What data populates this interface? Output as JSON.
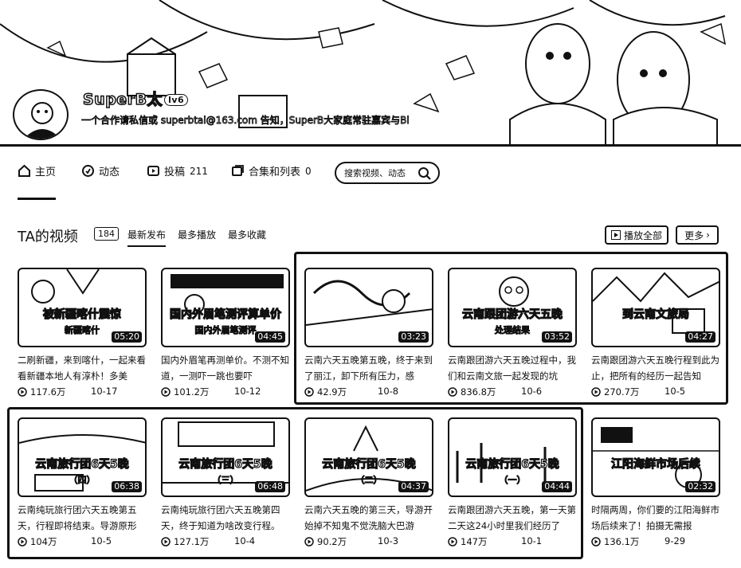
{
  "profile": {
    "username": "SuperB太",
    "level_badge": "lv6",
    "bio": "一个合作请私信或 superbtai@163.com 告知，SuperB大家庭常驻嘉宾与Bi"
  },
  "nav": {
    "items": [
      {
        "label": "主页",
        "count": "",
        "icon": "home-icon"
      },
      {
        "label": "动态",
        "count": "",
        "icon": "activity-icon"
      },
      {
        "label": "投稿",
        "count": "211",
        "icon": "upload-icon"
      },
      {
        "label": "合集和列表",
        "count": "0",
        "icon": "collection-icon"
      }
    ],
    "search_placeholder": "搜索视频、动态"
  },
  "section": {
    "title": "TA的视频",
    "count": "184",
    "sort_tabs": [
      "最新发布",
      "最多播放",
      "最多收藏"
    ],
    "play_all_label": "播放全部",
    "more_label": "更多"
  },
  "videos": [
    {
      "thumb_text": "被新疆喀什震惊",
      "thumb_sub": "新疆喀什",
      "duration": "05:20",
      "title": "二刷新疆，来到喀什，一起来看看新疆本地人有淳朴！多美",
      "views": "117.6万",
      "date": "10-17"
    },
    {
      "thumb_text": "国内外眉笔测评算单价",
      "thumb_sub": "国内外眉笔测评",
      "duration": "04:45",
      "title": "国内外眉笔再测单价。不测不知道，一测吓一跳也要吓",
      "views": "101.2万",
      "date": "10-12"
    },
    {
      "thumb_text": "",
      "thumb_sub": "",
      "duration": "03:23",
      "title": "云南六天五晚第五晚，终于来到了丽江，卸下所有压力，感",
      "views": "42.9万",
      "date": "10-8"
    },
    {
      "thumb_text": "云南跟团游六天五晚",
      "thumb_sub": "处理结果",
      "duration": "03:52",
      "title": "云南跟团游六天五晚过程中，我们和云南文旅一起发现的坑",
      "views": "836.8万",
      "date": "10-6"
    },
    {
      "thumb_text": "到云南文旅局",
      "thumb_sub": "",
      "duration": "04:27",
      "title": "云南跟团游六天五晚行程到此为止，把所有的经历一起告知",
      "views": "270.7万",
      "date": "10-5"
    },
    {
      "thumb_text": "云南旅行团6天5晚",
      "thumb_sub": "（四）",
      "duration": "06:38",
      "title": "云南纯玩旅行团六天五晚第五天，行程即将结束。导游原形",
      "views": "104万",
      "date": "10-5"
    },
    {
      "thumb_text": "云南旅行团6天5晚",
      "thumb_sub": "（三）",
      "duration": "06:48",
      "title": "云南纯玩旅行团六天五晚第四天，终于知道为啥改变行程。",
      "views": "127.1万",
      "date": "10-4"
    },
    {
      "thumb_text": "云南旅行团6天5晚",
      "thumb_sub": "（二）",
      "duration": "04:37",
      "title": "云南六天五晚的第三天，导游开始掉不知鬼不觉洗脑大巴游",
      "views": "90.2万",
      "date": "10-3"
    },
    {
      "thumb_text": "云南旅行团6天5晚",
      "thumb_sub": "（一）",
      "duration": "04:44",
      "title": "云南跟团游六天五晚，第一天第二天这24小时里我们经历了",
      "views": "147万",
      "date": "10-1"
    },
    {
      "thumb_text": "江阳海鲜市场后续",
      "thumb_sub": "",
      "duration": "02:32",
      "title": "时隔两周，你们要的江阳海鲜市场后续来了！拍摄无需报",
      "views": "136.1万",
      "date": "9-29"
    }
  ]
}
